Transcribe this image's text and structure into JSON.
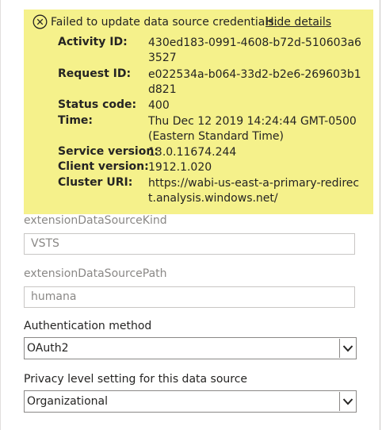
{
  "error": {
    "title": "Failed to update data source credentials:",
    "hide_details_label": "Hide details",
    "icon": "close-circle-icon",
    "background_color": "#f5f18b",
    "details": [
      {
        "label": "Activity ID:",
        "value": "430ed183-0991-4608-b72d-510603a63527"
      },
      {
        "label": "Request ID:",
        "value": "e022534a-b064-33d2-b2e6-269603b1d821"
      },
      {
        "label": "Status code:",
        "value": "400"
      },
      {
        "label": "Time:",
        "value": "Thu Dec 12 2019 14:24:44 GMT-0500 (Eastern Standard Time)"
      },
      {
        "label": "Service version:",
        "value": "13.0.11674.244"
      },
      {
        "label": "Client version:",
        "value": "1912.1.020"
      },
      {
        "label": "Cluster URI:",
        "value": "https://wabi-us-east-a-primary-redirect.analysis.windows.net/"
      }
    ]
  },
  "fields": {
    "kind": {
      "label": "extensionDataSourceKind",
      "value": "VSTS"
    },
    "path": {
      "label": "extensionDataSourcePath",
      "value": "humana"
    },
    "auth_method": {
      "label": "Authentication method",
      "value": "OAuth2"
    },
    "privacy_level": {
      "label": "Privacy level setting for this data source",
      "value": "Organizational"
    }
  }
}
